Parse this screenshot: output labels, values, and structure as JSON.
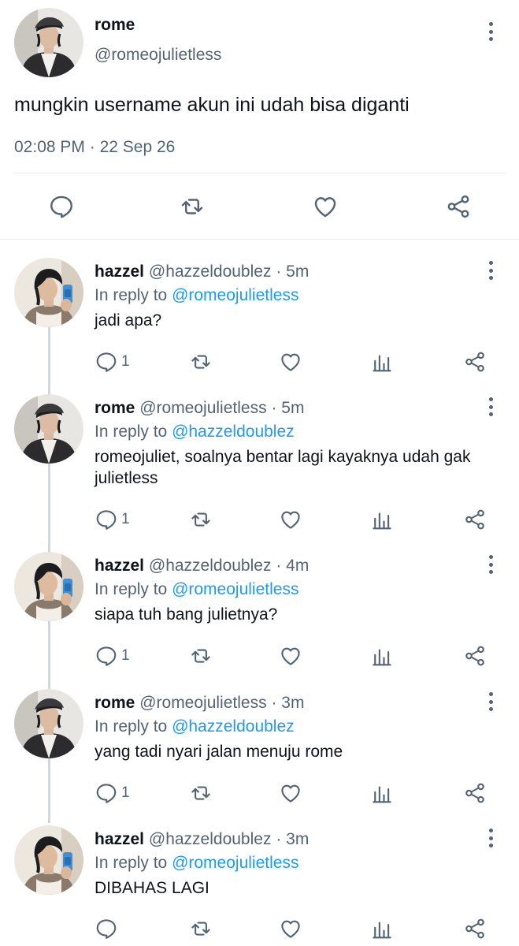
{
  "main_tweet": {
    "name": "rome",
    "handle": "@romeojulietless",
    "text": "mungkin username akun ini udah bisa diganti",
    "time": "02:08 PM",
    "date_sep": "·",
    "date": "22 Sep 26",
    "icons": [
      "reply-icon",
      "retweet-icon",
      "like-icon",
      "share-icon"
    ]
  },
  "replies": [
    {
      "name": "hazzel",
      "handle": "@hazzeldoublez",
      "age": "· 5m",
      "in_reply_label": "In reply to",
      "in_reply_to": "@romeojulietless",
      "text": "jadi apa?",
      "reply_count": "1"
    },
    {
      "name": "rome",
      "handle": "@romeojulietless",
      "age": "· 5m",
      "in_reply_label": "In reply to",
      "in_reply_to": "@hazzeldoublez",
      "text": "romeojuliet, soalnya bentar lagi kayaknya udah gak julietless",
      "reply_count": "1"
    },
    {
      "name": "hazzel",
      "handle": "@hazzeldoublez",
      "age": "· 4m",
      "in_reply_label": "In reply to",
      "in_reply_to": "@romeojulietless",
      "text": "siapa tuh bang julietnya?",
      "reply_count": "1"
    },
    {
      "name": "rome",
      "handle": "@romeojulietless",
      "age": "· 3m",
      "in_reply_label": "In reply to",
      "in_reply_to": "@hazzeldoublez",
      "text": "yang tadi nyari jalan menuju rome",
      "reply_count": "1"
    },
    {
      "name": "hazzel",
      "handle": "@hazzeldoublez",
      "age": "· 3m",
      "in_reply_label": "In reply to",
      "in_reply_to": "@romeojulietless",
      "text": "DIBAHAS LAGI",
      "reply_count": ""
    }
  ],
  "colors": {
    "accent": "#1d9bf0",
    "secondary_text": "#536471",
    "divider": "#e6ecf0"
  }
}
